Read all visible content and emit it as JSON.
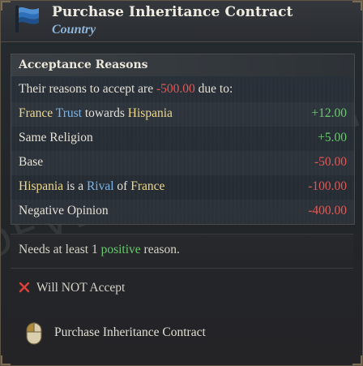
{
  "header": {
    "title": "Purchase Inheritance Contract",
    "subtitle": "Country",
    "flag_icon": "blue-flag-icon"
  },
  "acceptance": {
    "heading": "Acceptance Reasons",
    "summary": {
      "prefix": "Their reasons to accept are ",
      "value": "-500.00",
      "suffix": " due to:"
    },
    "rows": [
      {
        "parts": [
          {
            "text": "France",
            "style": "gold"
          },
          {
            "text": " Trust",
            "style": "blue"
          },
          {
            "text": " towards ",
            "style": "plain"
          },
          {
            "text": "Hispania",
            "style": "gold"
          }
        ],
        "value": "+12.00",
        "sign": "pos"
      },
      {
        "parts": [
          {
            "text": "Same Religion",
            "style": "plain"
          }
        ],
        "value": "+5.00",
        "sign": "pos"
      },
      {
        "parts": [
          {
            "text": "Base",
            "style": "plain"
          }
        ],
        "value": "-50.00",
        "sign": "neg"
      },
      {
        "parts": [
          {
            "text": "Hispania",
            "style": "gold"
          },
          {
            "text": " is a ",
            "style": "plain"
          },
          {
            "text": "Rival",
            "style": "blue"
          },
          {
            "text": " of ",
            "style": "plain"
          },
          {
            "text": "France",
            "style": "gold"
          }
        ],
        "value": "-100.00",
        "sign": "neg"
      },
      {
        "parts": [
          {
            "text": "Negative Opinion",
            "style": "plain"
          }
        ],
        "value": "-400.00",
        "sign": "neg"
      }
    ]
  },
  "requirement": {
    "prefix": "Needs at least ",
    "count": "1",
    "keyword": " positive",
    "suffix": " reason."
  },
  "verdict": {
    "icon": "red-x-icon",
    "text": "Will NOT Accept"
  },
  "action": {
    "icon": "mouse-left-click-icon",
    "text": "Purchase Inheritance Contract"
  },
  "watermark": "DEVELOPMENT IN DEV",
  "colors": {
    "gold": "#f0d98a",
    "blue": "#7eb6e6",
    "positive": "#6cc96f",
    "negative": "#e05a55"
  }
}
